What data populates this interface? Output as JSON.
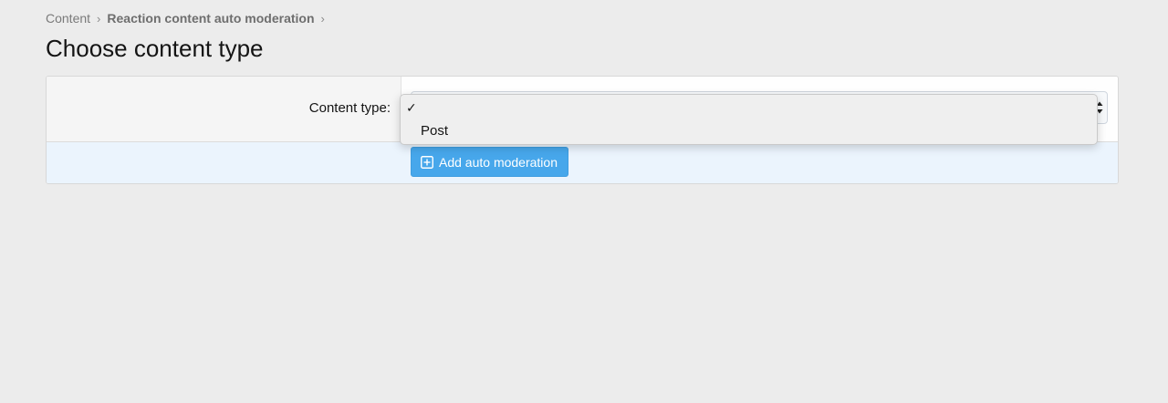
{
  "breadcrumb": {
    "items": [
      {
        "label": "Content"
      },
      {
        "label": "Reaction content auto moderation"
      }
    ],
    "separator": "›"
  },
  "page": {
    "title": "Choose content type"
  },
  "form": {
    "content_type_label": "Content type:",
    "content_type_value": "",
    "submit_label": "Add auto moderation"
  },
  "dropdown": {
    "selected_mark": "✓",
    "options": [
      {
        "label": "",
        "selected": true
      },
      {
        "label": "Post",
        "selected": false
      }
    ]
  },
  "colors": {
    "background": "#ececec",
    "button": "#47a7eb",
    "footer": "#ebf4fd"
  },
  "icons": {
    "select_arrows": "select-arrows-icon",
    "add": "plus-square-icon"
  }
}
